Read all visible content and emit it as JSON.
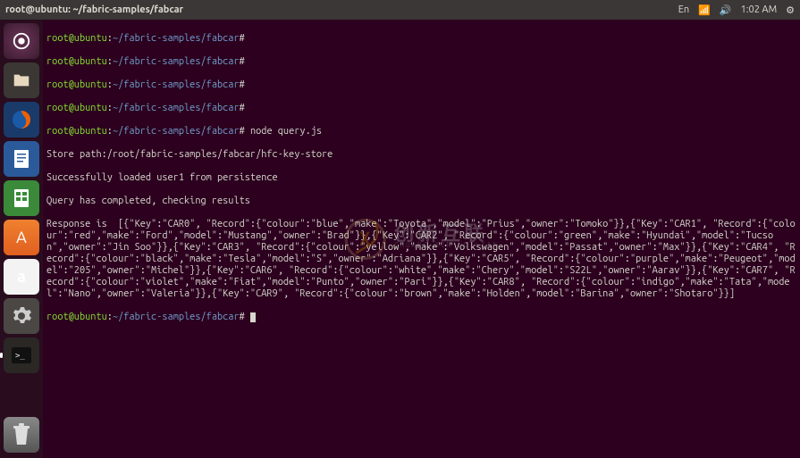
{
  "panel": {
    "title": "root@ubuntu: ~/fabric-samples/fabcar",
    "time": "1:02 AM",
    "keyboard": "En"
  },
  "terminal": {
    "prompt_user": "root@ubuntu",
    "prompt_path": "~/fabric-samples/fabcar",
    "prompt_symbol": "#",
    "lines_before": [
      "",
      "",
      "",
      ""
    ],
    "command": "node query.js",
    "out1": "Store path:/root/fabric-samples/fabcar/hfc-key-store",
    "out2": "Successfully loaded user1 from persistence",
    "out3": "Query has completed, checking results",
    "response_label": "Response is  ",
    "response_body": "[{\"Key\":\"CAR0\", \"Record\":{\"colour\":\"blue\",\"make\":\"Toyota\",\"model\":\"Prius\",\"owner\":\"Tomoko\"}},{\"Key\":\"CAR1\", \"Record\":{\"colour\":\"red\",\"make\":\"Ford\",\"model\":\"Mustang\",\"owner\":\"Brad\"}},{\"Key\":\"CAR2\", \"Record\":{\"colour\":\"green\",\"make\":\"Hyundai\",\"model\":\"Tucson\",\"owner\":\"Jin Soo\"}},{\"Key\":\"CAR3\", \"Record\":{\"colour\":\"yellow\",\"make\":\"Volkswagen\",\"model\":\"Passat\",\"owner\":\"Max\"}},{\"Key\":\"CAR4\", \"Record\":{\"colour\":\"black\",\"make\":\"Tesla\",\"model\":\"S\",\"owner\":\"Adriana\"}},{\"Key\":\"CAR5\", \"Record\":{\"colour\":\"purple\",\"make\":\"Peugeot\",\"model\":\"205\",\"owner\":\"Michel\"}},{\"Key\":\"CAR6\", \"Record\":{\"colour\":\"white\",\"make\":\"Chery\",\"model\":\"S22L\",\"owner\":\"Aarav\"}},{\"Key\":\"CAR7\", \"Record\":{\"colour\":\"violet\",\"make\":\"Fiat\",\"model\":\"Punto\",\"owner\":\"Pari\"}},{\"Key\":\"CAR8\", \"Record\":{\"colour\":\"indigo\",\"make\":\"Tata\",\"model\":\"Nano\",\"owner\":\"Valeria\"}},{\"Key\":\"CAR9\", \"Record\":{\"colour\":\"brown\",\"make\":\"Holden\",\"model\":\"Barina\",\"owner\":\"Shotaro\"}}]"
  },
  "launcher_icons": {
    "dash": "⌕",
    "files": "🗂",
    "firefox": "🦊",
    "writer": "📄",
    "calc": "📊",
    "store": "A",
    "amazon": "a",
    "settings": "⚙",
    "terminal": ">_",
    "trash": "🗑"
  },
  "watermark": {
    "cn": "创新互联",
    "en": "CHUANG XIN HU LIAN",
    "logo": "X"
  }
}
